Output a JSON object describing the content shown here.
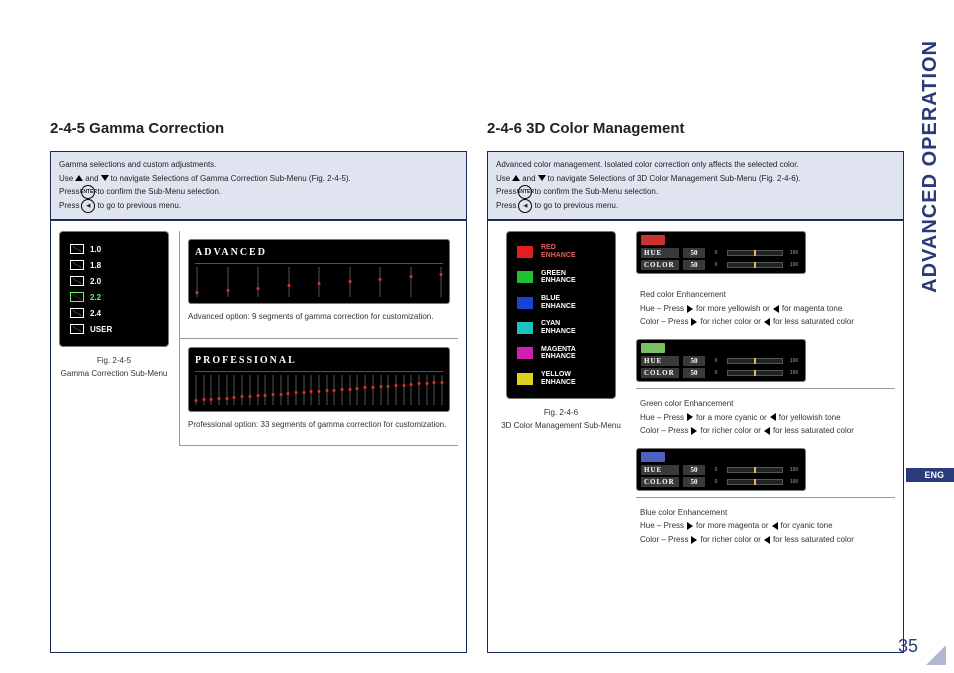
{
  "sideTab": "ADVANCED OPERATION",
  "langTab": "ENG",
  "pageNumber": "35",
  "left": {
    "title": "2-4-5 Gamma Correction",
    "intro": {
      "l1": "Gamma selections and custom adjustments.",
      "l2a": "Use ",
      "l2b": " and ",
      "l2c": " to navigate Selections of Gamma Correction Sub-Menu (Fig. 2-4-5).",
      "l3a": "Press ",
      "l3b": " to confirm the Sub-Menu selection.",
      "l4a": "Press ",
      "l4b": " to go to previous menu.",
      "enterIcon": "ENTER",
      "backIcon": "◀"
    },
    "menu": {
      "items": [
        "1.0",
        "1.8",
        "2.0",
        "2.2",
        "2.4",
        "USER"
      ],
      "activeIndex": 3,
      "caption1": "Fig. 2-4-5",
      "caption2": "Gamma Correction Sub-Menu"
    },
    "adv": {
      "title": "ADVANCED",
      "desc": "Advanced option: 9 segments of gamma correction for customization.",
      "segments": 9
    },
    "pro": {
      "title": "PROFESSIONAL",
      "desc": "Professional option: 33 segments of gamma correction for customization.",
      "segments": 33
    }
  },
  "right": {
    "title": "2-4-6 3D Color Management",
    "intro": {
      "l1": "Advanced color management. Isolated color correction only affects the selected color.",
      "l2a": "Use ",
      "l2b": " and ",
      "l2c": " to navigate Selections of 3D Color Management Sub-Menu (Fig. 2-4-6).",
      "l3a": "Press ",
      "l3b": " to confirm the Sub-Menu selection.",
      "l4a": "Press ",
      "l4b": " to go to previous menu.",
      "enterIcon": "ENTER",
      "backIcon": "◀"
    },
    "menu": {
      "items": [
        {
          "label": "RED ENHANCE",
          "cls": "sw-red",
          "active": true
        },
        {
          "label": "GREEN ENHANCE",
          "cls": "sw-green"
        },
        {
          "label": "BLUE ENHANCE",
          "cls": "sw-blue"
        },
        {
          "label": "CYAN ENHANCE",
          "cls": "sw-cyan"
        },
        {
          "label": "MAGENTA ENHANCE",
          "cls": "sw-magenta"
        },
        {
          "label": "YELLOW ENHANCE",
          "cls": "sw-yellow"
        }
      ],
      "caption1": "Fig. 2-4-6",
      "caption2": "3D Color Management Sub-Menu"
    },
    "widgets": {
      "hueLabel": "HUE",
      "colorLabel": "COLOR",
      "value": "50",
      "min": "0",
      "max": "100"
    },
    "enh": [
      {
        "badge": "#cc3030",
        "title": "Red color Enhancement",
        "hue1": "Hue – Press ",
        "hue2": " for more yellowish or ",
        "hue3": " for magenta tone",
        "col1": "Color – Press ",
        "col2": " for richer color or ",
        "col3": " for less saturated color"
      },
      {
        "badge": "#7ac060",
        "title": "Green color Enhancement",
        "hue1": "Hue – Press ",
        "hue2": " for a more cyanic or ",
        "hue3": " for yellowish tone",
        "col1": "Color – Press ",
        "col2": " for richer color or ",
        "col3": " for less saturated color"
      },
      {
        "badge": "#5060c0",
        "title": "Blue color Enhancement",
        "hue1": "Hue – Press ",
        "hue2": " for more magenta or ",
        "hue3": " for cyanic tone",
        "col1": "Color – Press ",
        "col2": " for richer color or ",
        "col3": " for less saturated color"
      }
    ]
  }
}
